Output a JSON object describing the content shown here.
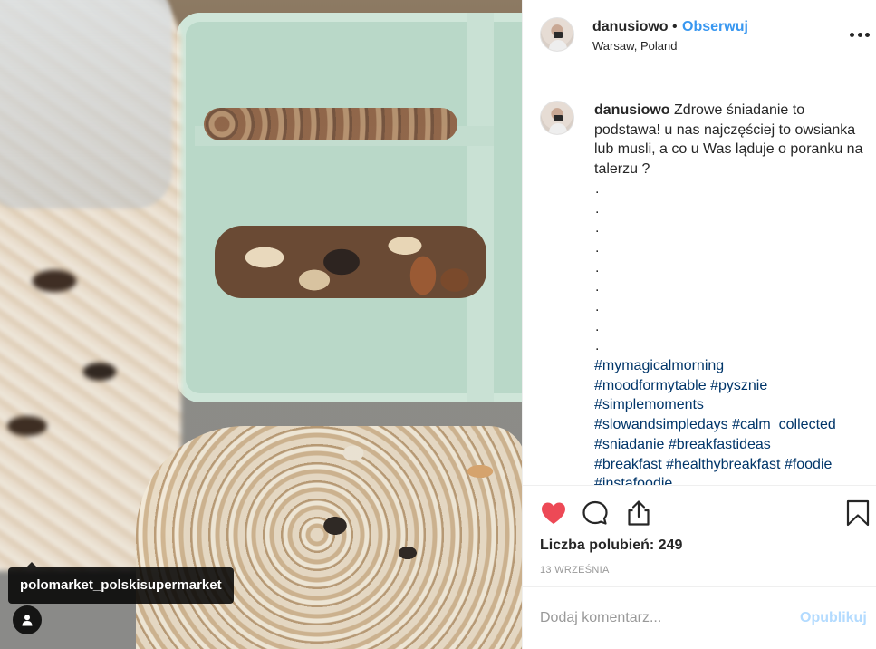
{
  "photo": {
    "tagged_user": "polomarket_polskisupermarket",
    "user_tag_icon": "person-icon"
  },
  "header": {
    "username": "danusiowo",
    "separator": "•",
    "follow_label": "Obserwuj",
    "location": "Warsaw, Poland",
    "more_icon": "ellipsis-icon"
  },
  "caption": {
    "username": "danusiowo",
    "text": "Zdrowe śniadanie to podstawa! u nas najczęściej to owsianka lub musli, a co u Was ląduje o poranku na talerzu ?",
    "dots": [
      ".",
      ".",
      ".",
      ".",
      ".",
      ".",
      ".",
      ".",
      "."
    ],
    "hashtag_lines": [
      "#mymagicalmorning",
      "#moodformytable #pysznie",
      "#simplemoments",
      "#slowandsimpledays #calm_collected",
      "#sniadanie #breakfastideas",
      "#breakfast #healthybreakfast #foodie",
      "#instafoodie"
    ]
  },
  "actions": {
    "like_icon": "heart-icon",
    "comment_icon": "comment-icon",
    "share_icon": "share-icon",
    "save_icon": "bookmark-icon",
    "like_color": "#ed4956",
    "likes_text": "Liczba polubień: 249",
    "date": "13 WRZEŚNIA"
  },
  "comment": {
    "placeholder": "Dodaj komentarz...",
    "post_label": "Opublikuj",
    "post_color": "#b3dbff"
  },
  "colors": {
    "link": "#3897f0",
    "hashtag": "#003569",
    "text": "#262626",
    "muted": "#999999"
  }
}
